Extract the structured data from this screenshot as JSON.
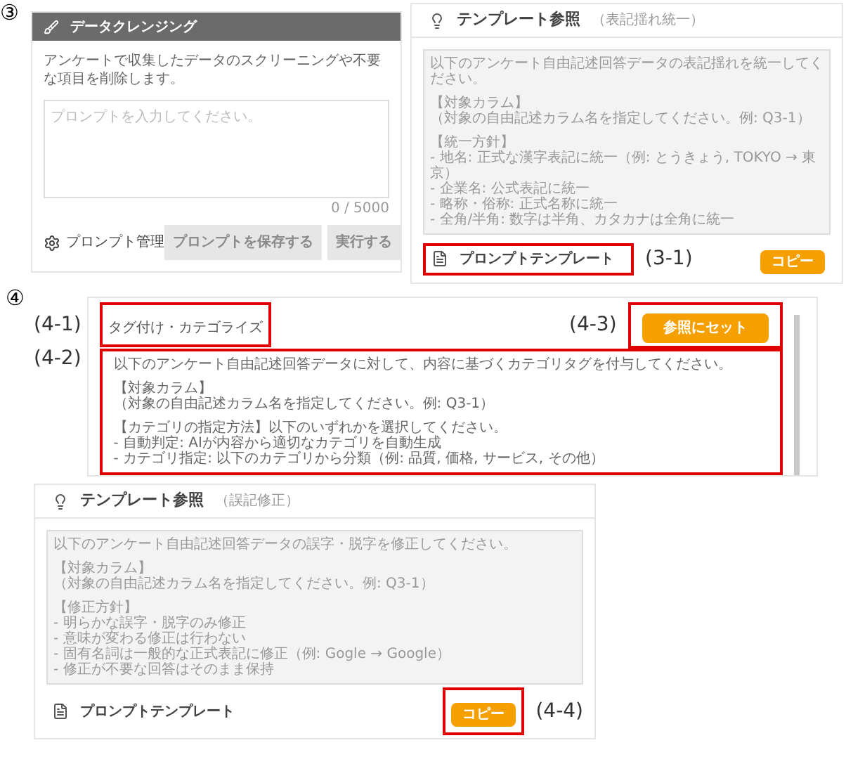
{
  "cleansing_section": {
    "marker": "③",
    "header": {
      "title": "データクレンジング"
    },
    "description": "アンケートで収集したデータのスクリーニングや不要な項目を削除します。",
    "prompt_field": {
      "placeholder": "プロンプトを入力してください。"
    },
    "char_count": "0 / 5000",
    "manage_link": "プロンプト管理",
    "buttons": [
      {
        "label": "プロンプトを保存する",
        "disabled": true
      },
      {
        "label": "実行する",
        "disabled": true
      }
    ]
  },
  "template_card_top": {
    "title": "テンプレート参照",
    "subtitle": "（表記揺れ統一）",
    "paragraphs": [
      [
        "以下のアンケート自由記述回答データの表記揺れを統一してください。"
      ],
      [
        "【対象カラム】",
        "（対象の自由記述カラム名を指定してください。例: Q3-1）"
      ],
      [
        "【統一方針】",
        "- 地名: 正式な漢字表記に統一（例: とうきょう, TOKYO → 東京）",
        "- 企業名: 公式表記に統一",
        "- 略称・俗称: 正式名称に統一",
        "- 全角/半角: 数字は半角、カタカナは全角に統一"
      ]
    ],
    "footer": {
      "label": "プロンプトテンプレート",
      "highlighted": true,
      "callout": "(3-1)"
    },
    "copy_button": {
      "label": "コピー",
      "highlighted": false
    }
  },
  "tagging_section": {
    "marker": "④",
    "title": {
      "text": "タグ付け・カテゴライズ",
      "highlighted": true,
      "callout": "(4-1)"
    },
    "set_button": {
      "label": "参照にセット",
      "highlighted": true,
      "callout": "(4-3)"
    },
    "body": {
      "highlighted": true,
      "callout": "(4-2)",
      "paragraphs": [
        [
          "以下のアンケート自由記述回答データに対して、内容に基づくカテゴリタグを付与してください。"
        ],
        [
          "【対象カラム】",
          "（対象の自由記述カラム名を指定してください。例: Q3-1）"
        ],
        [
          "【カテゴリの指定方法】以下のいずれかを選択してください。",
          "- 自動判定: AIが内容から適切なカテゴリを自動生成",
          "- カテゴリ指定: 以下のカテゴリから分類（例: 品質, 価格, サービス, その他）"
        ]
      ]
    }
  },
  "template_card_bottom": {
    "title": "テンプレート参照",
    "subtitle": "（誤記修正）",
    "paragraphs": [
      [
        "以下のアンケート自由記述回答データの誤字・脱字を修正してください。"
      ],
      [
        "【対象カラム】",
        "（対象の自由記述カラム名を指定してください。例: Q3-1）"
      ],
      [
        "【修正方針】",
        "- 明らかな誤字・脱字のみ修正",
        "- 意味が変わる修正は行わない",
        "- 固有名詞は一般的な正式表記に修正（例: Gogle → Google）",
        "- 修正が不要な回答はそのまま保持"
      ]
    ],
    "footer": {
      "label": "プロンプトテンプレート",
      "highlighted": false
    },
    "copy_button": {
      "label": "コピー",
      "highlighted": true,
      "callout": "(4-4)"
    }
  }
}
